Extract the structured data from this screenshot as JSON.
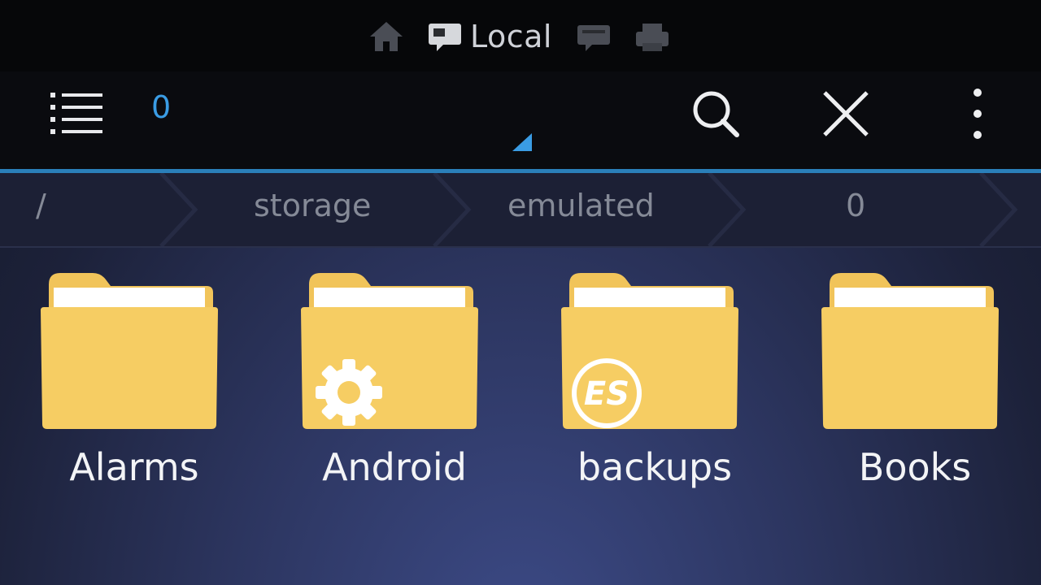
{
  "window_tabs": [
    {
      "icon": "home-icon",
      "label": ""
    },
    {
      "icon": "local-storage-icon",
      "label": "Local"
    },
    {
      "icon": "network-icon",
      "label": ""
    },
    {
      "icon": "printer-icon",
      "label": ""
    }
  ],
  "toolbar": {
    "current_dir": "0"
  },
  "breadcrumb": [
    "/",
    "storage",
    "emulated",
    "0"
  ],
  "folders": [
    {
      "name": "Alarms",
      "badge": ""
    },
    {
      "name": "Android",
      "badge": "gear-icon"
    },
    {
      "name": "backups",
      "badge": "es-logo-icon"
    },
    {
      "name": "Books",
      "badge": ""
    }
  ],
  "colors": {
    "accent": "#3a9ce4",
    "folder": "#f6cd63",
    "folder_tab": "#f1c45a"
  }
}
